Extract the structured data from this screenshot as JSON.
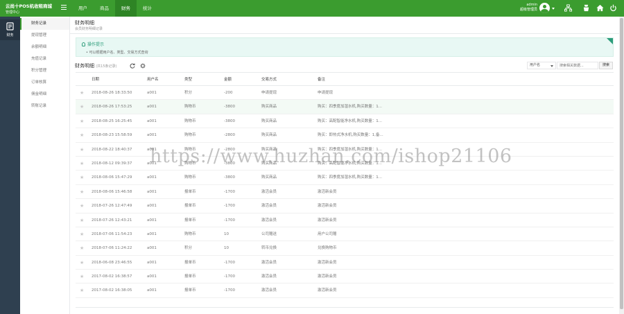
{
  "header": {
    "brand_title": "云尚十POS机收租商城",
    "brand_sub": "管理中心",
    "tabs": [
      "用户",
      "商品",
      "财务",
      "统计"
    ],
    "active_tab": 2,
    "user_name": "admin",
    "user_role": "超级管理员"
  },
  "rail": {
    "label": "财务"
  },
  "submenu": {
    "items": [
      "财务记录",
      "提现管理",
      "余额明细",
      "充值记录",
      "积分管理",
      "订单核算",
      "佣金明细",
      "转账记录"
    ]
  },
  "page": {
    "title": "财务明细",
    "subtitle": "会员财务明细记录"
  },
  "tips": {
    "title": "操作提示",
    "items": [
      "• 可以根据用户名、类型、交易方式查询"
    ]
  },
  "list": {
    "title": "财务明细",
    "count": "(共15条记录)",
    "filter_value": "用户名",
    "search_placeholder": "搜索相关数据...",
    "search_label": "搜索"
  },
  "table": {
    "headers": [
      "日期",
      "用户名",
      "类型",
      "金额",
      "交易方式",
      "备注"
    ],
    "rows": [
      [
        "2018-08-26 18:33:50",
        "a001",
        "积分",
        "-200",
        "申请提现",
        "申请提现"
      ],
      [
        "2018-08-26 17:53:25",
        "a001",
        "购物币",
        "-3800",
        "购买商品",
        "购买：四季度加湿水机,购买数量：1..."
      ],
      [
        "2018-08-25 16:25:45",
        "a001",
        "购物币",
        "-3800",
        "购买商品",
        "购买：高配智能净水机,购买数量：1..."
      ],
      [
        "2018-08-23 15:58:59",
        "a001",
        "购物币",
        "-2800",
        "购买商品",
        "购买：即热式净水机,购买数量：1,备..."
      ],
      [
        "2018-08-22 18:40:37",
        "a001",
        "购物币",
        "-2800",
        "购买商品",
        "购买：四季度加湿水机,购买数量：1..."
      ],
      [
        "2018-08-12 09:39:37",
        "a001",
        "购物币",
        "-3800",
        "购买商品",
        "购买：高配智能净水机,购买数量：1..."
      ],
      [
        "2018-08-06 15:47:29",
        "a001",
        "购物币",
        "-3800",
        "购买商品",
        "购买：四季度加湿水机,购买数量：1..."
      ],
      [
        "2018-08-06 15:46:58",
        "a001",
        "报单币",
        "-1700",
        "激活会员",
        "激活新会员"
      ],
      [
        "2018-07-26 12:47:49",
        "a001",
        "报单币",
        "-1700",
        "激活会员",
        "激活新会员"
      ],
      [
        "2018-07-26 12:43:21",
        "a001",
        "报单币",
        "-1700",
        "激活会员",
        "激活新会员"
      ],
      [
        "2018-07-06 11:54:23",
        "a001",
        "购物币",
        "10",
        "公司赠送",
        "用户公司赠"
      ],
      [
        "2018-07-06 11:24:22",
        "a001",
        "积分",
        "10",
        "转币兑换",
        "兑换购物币"
      ],
      [
        "2018-06-08 23:46:55",
        "a001",
        "报单币",
        "-1700",
        "激活会员",
        "激活新会员"
      ],
      [
        "2017-08-02 16:38:57",
        "a001",
        "报单币",
        "-1700",
        "激活会员",
        "激活新会员"
      ],
      [
        "2017-08-02 16:38:05",
        "a001",
        "报单币",
        "-1700",
        "激活会员",
        "激活新会员"
      ]
    ]
  },
  "watermark": "https://www.huzhan.com/ishop21106",
  "colors": {
    "accent": "#3b9c2f",
    "accent_dark": "#2e8425",
    "rail": "#2f4050",
    "tips_bg": "#e8f8f4"
  }
}
